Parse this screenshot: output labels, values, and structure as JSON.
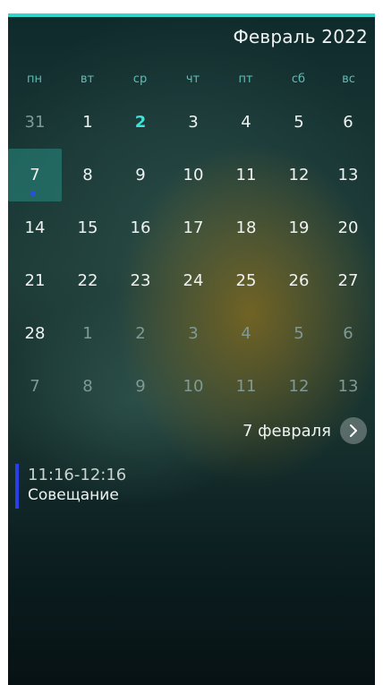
{
  "calendar": {
    "month_title": "Февраль 2022",
    "weekdays": [
      "пн",
      "вт",
      "ср",
      "чт",
      "пт",
      "сб",
      "вс"
    ],
    "weeks": [
      [
        {
          "day": "31",
          "state": "out"
        },
        {
          "day": "1",
          "state": "in"
        },
        {
          "day": "2",
          "state": "today"
        },
        {
          "day": "3",
          "state": "in"
        },
        {
          "day": "4",
          "state": "in"
        },
        {
          "day": "5",
          "state": "in"
        },
        {
          "day": "6",
          "state": "in"
        }
      ],
      [
        {
          "day": "7",
          "state": "selected",
          "has_event": true
        },
        {
          "day": "8",
          "state": "in"
        },
        {
          "day": "9",
          "state": "in"
        },
        {
          "day": "10",
          "state": "in"
        },
        {
          "day": "11",
          "state": "in"
        },
        {
          "day": "12",
          "state": "in"
        },
        {
          "day": "13",
          "state": "in"
        }
      ],
      [
        {
          "day": "14",
          "state": "in"
        },
        {
          "day": "15",
          "state": "in"
        },
        {
          "day": "16",
          "state": "in"
        },
        {
          "day": "17",
          "state": "in"
        },
        {
          "day": "18",
          "state": "in"
        },
        {
          "day": "19",
          "state": "in"
        },
        {
          "day": "20",
          "state": "in"
        }
      ],
      [
        {
          "day": "21",
          "state": "in"
        },
        {
          "day": "22",
          "state": "in"
        },
        {
          "day": "23",
          "state": "in"
        },
        {
          "day": "24",
          "state": "in"
        },
        {
          "day": "25",
          "state": "in"
        },
        {
          "day": "26",
          "state": "in"
        },
        {
          "day": "27",
          "state": "in"
        }
      ],
      [
        {
          "day": "28",
          "state": "in"
        },
        {
          "day": "1",
          "state": "out"
        },
        {
          "day": "2",
          "state": "out"
        },
        {
          "day": "3",
          "state": "out"
        },
        {
          "day": "4",
          "state": "out"
        },
        {
          "day": "5",
          "state": "out"
        },
        {
          "day": "6",
          "state": "out"
        }
      ],
      [
        {
          "day": "7",
          "state": "out"
        },
        {
          "day": "8",
          "state": "out"
        },
        {
          "day": "9",
          "state": "out"
        },
        {
          "day": "10",
          "state": "out"
        },
        {
          "day": "11",
          "state": "out"
        },
        {
          "day": "12",
          "state": "out"
        },
        {
          "day": "13",
          "state": "out"
        }
      ]
    ]
  },
  "selected_date": {
    "label": "7 февраля",
    "next_icon": "chevron-right-icon"
  },
  "events": [
    {
      "time": "11:16-12:16",
      "title": "Совещание",
      "color": "#2a3fe8"
    }
  ],
  "colors": {
    "accent": "#2fd6cc",
    "today": "#42e0d6",
    "weekday_label": "#5fbdb4",
    "event_dot": "#2a4fe0"
  }
}
